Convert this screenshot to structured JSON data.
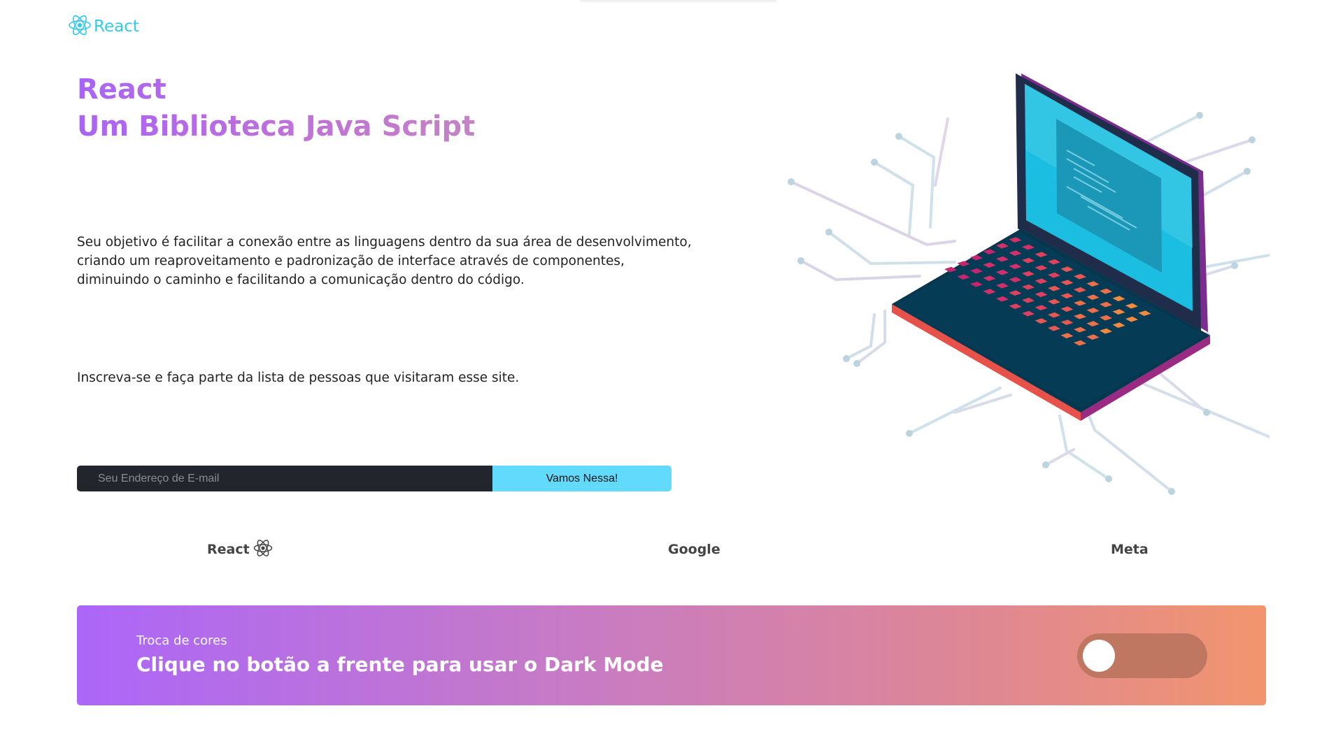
{
  "nav": {
    "brand_label": "React"
  },
  "hero": {
    "title_line1": "React",
    "title_line2": "Um Biblioteca Java Script",
    "description": "Seu objetivo é facilitar a conexão entre as linguagens dentro da sua área de desenvolvimento, criando um reaproveitamento e padronização de interface através de componentes, diminuindo o caminho e facilitando a comunicação dentro do código.",
    "subscribe_text": "Inscreva-se e faça parte da lista de pessoas que visitaram esse site."
  },
  "form": {
    "email_placeholder": "Seu Endereço de E-mail",
    "email_value": "",
    "button_label": "Vamos Nessa!"
  },
  "partners": [
    {
      "label": "React",
      "icon": "react-atom-icon"
    },
    {
      "label": "Google"
    },
    {
      "label": "Meta"
    }
  ],
  "banner": {
    "small_text": "Troca de cores",
    "title": "Clique no botão a frente para usar o Dark Mode",
    "toggle_on": false
  },
  "colors": {
    "react_accent": "#61dafb",
    "title_gradient_start": "#a864f6",
    "banner_gradient_start": "#ac66f8",
    "banner_gradient_end": "#f2956e",
    "toggle_track": "#c07761",
    "input_background": "#22252b"
  }
}
